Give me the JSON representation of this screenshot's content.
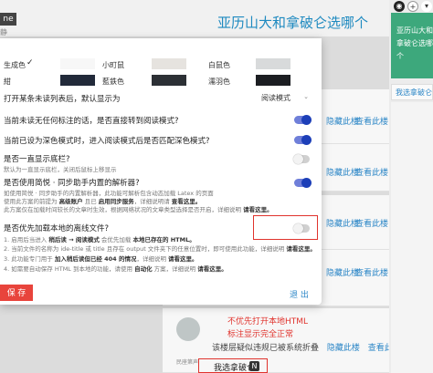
{
  "background": {
    "title": "亚历山大和拿破仑选哪个",
    "left_tag": "ne",
    "left_tag2": "静",
    "row_links": [
      {
        "left": "隐藏此楼",
        "right": "查看此楼"
      },
      {
        "left": "隐藏此楼",
        "right": "查看此楼"
      },
      {
        "left": "隐藏此楼",
        "right": "查看此楼"
      },
      {
        "left": "隐藏此楼",
        "right": "查看此楼"
      },
      {
        "left": "隐藏此楼",
        "right": "查看此楼"
      }
    ],
    "hint_text": "该楼层疑似违规已被系统折叠",
    "hint_links": [
      "隐藏此楼",
      "查看此楼"
    ],
    "bottom_note": "民座第声",
    "bottom_link": "我选拿破仑",
    "bottom_badge": "N"
  },
  "annotation": {
    "line1": "不优先打开本地HTML",
    "line2": "标注显示完全正常"
  },
  "right_panel": {
    "icons": [
      {
        "name": "eye-icon",
        "glyph": "◉"
      },
      {
        "name": "plus-icon",
        "glyph": "+"
      },
      {
        "name": "chevron-icon",
        "glyph": "▾"
      }
    ],
    "green_title": "亚历山大和拿破仑选哪个",
    "item": "我选拿破仑"
  },
  "dialog": {
    "themes": [
      {
        "label": "生成色",
        "checked": true,
        "color": "#f7f7f7"
      },
      {
        "label": "小町鼠",
        "checked": false,
        "color": "#e6e3df"
      },
      {
        "label": "白鼠色",
        "checked": false,
        "color": "#d8dadb"
      },
      {
        "label": "紺",
        "checked": false,
        "color": "#222a3a"
      },
      {
        "label": "藍鉄色",
        "checked": false,
        "color": "#2c3035"
      },
      {
        "label": "濡羽色",
        "checked": false,
        "color": "#1c1e22"
      }
    ],
    "check_mark": "✓",
    "open_unread": {
      "label": "打开某条未读列表后，默认显示为",
      "value": "阅读模式",
      "arrow": "⌄"
    },
    "options": [
      {
        "label": "当前未读无任何标注的话，是否直接转到阅读模式?",
        "sub": "",
        "on": true
      },
      {
        "label": "当前已设为深色模式时，进入阅读模式后是否匹配深色模式?",
        "sub": "",
        "on": true
      },
      {
        "label": "是否一直显示底栏?",
        "sub": "默认为一直显示底栏，关闭后鼠标上移显示",
        "on": false
      },
      {
        "label": "是否使用简悦 · 同步助手内置的解析器?",
        "sub": "",
        "on": true
      },
      {
        "label": "是否优先加载本地的离线文件?",
        "sub": "",
        "on": false
      }
    ],
    "sync_sub1_a": "如使用简悦 · 同步助手的内置解析器，此功能可解析包含动态加载 Latex 的页面",
    "sync_sub2_a": "使用此方案的前提为 ",
    "sync_sub2_b": "高级账户",
    "sync_sub2_c": " 且已 ",
    "sync_sub2_d": "启用同步服务",
    "sync_sub2_e": "，详细说明请 ",
    "sync_sub2_f": "查看这里。",
    "sync_sub3_a": "此方案仅在加载时间较长的文章时生效，根据网络状况的文章类型选择是否开启，详细说明 ",
    "sync_sub3_b": "请看这里。",
    "local_sub1_a": "1. 启用后当进入 ",
    "local_sub1_b": "稍后读 → 阅读模式",
    "local_sub1_c": " 会优先加载 ",
    "local_sub1_d": "本地已存在的 HTML。",
    "local_sub2_a": "2. 当前文件的名称为 ",
    "local_sub2_b": "ide-title 或 title",
    "local_sub2_c": " 且存在 output 文件夹下的任意位置时，即可使用此功能，详细说明 ",
    "local_sub2_d": "请看这里。",
    "local_sub3_a": "3. 此功能专门用于 ",
    "local_sub3_b": "加入稍后读但已经 404 的情况",
    "local_sub3_c": "，详细说明 ",
    "local_sub3_d": "请看这里。",
    "local_sub4_a": "4. 如需要自动保存 HTML 到本地的功能，请使用 ",
    "local_sub4_b": "自动化",
    "local_sub4_c": " 方案，详细说明 ",
    "local_sub4_d": "请看这里。",
    "save": "保 存",
    "exit": "退 出"
  }
}
